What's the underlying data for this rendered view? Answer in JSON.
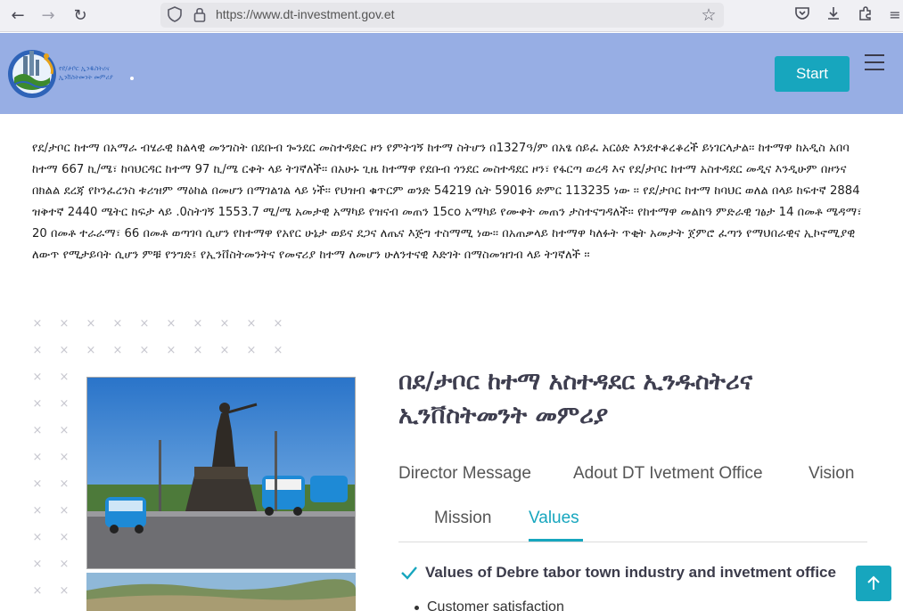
{
  "browser": {
    "url": "https://www.dt-investment.gov.et",
    "back_icon": "←",
    "forward_icon": "→",
    "reload_icon": "↻",
    "shield_icon": "⛉",
    "lock_icon": "🔒",
    "star_icon": "☆",
    "pocket_icon": "◘",
    "download_icon": "⤓",
    "extensions_icon": "✚",
    "menu_icon": "≡"
  },
  "header": {
    "start_label": "Start",
    "bg_color": "#97aee4",
    "accent_color": "#17a6be"
  },
  "intro": {
    "paragraph": "የደ/ታቦር ከተማ በአማራ ብሄራዊ ክልላዊ መንግስት በደቡብ ጐንደር መስተዳድር ዞን የምትገኝ ከተማ ስትሆን በ1327ዓ/ም በአፄ ሰይፈ አርዕድ እንደተቆረቆረች ይነገርላታል፡፡ ከተማዋ ከአዲስ አበባ ከተማ 667 ኪ/ሜ፣ ከባህርዳር ከተማ 97 ኪ/ሜ ርቀት ላይ ትገኛለች፡፡ በአሁኑ ጊዜ ከተማዋ የደቡብ ጎንደር መስተዳደር ዞን፣ የፋርጣ ወረዳ እና የደ/ታቦር ከተማ አስተዳደር መዲና እንዲሁም በዞንና በክልል ደረጃ የኮንፈረንስ ቱሪዝም ማዕከል በመሆን በማገልገል ላይ ነች፡፡ የህዝብ ቁጥርም ወንድ 54219 ሴት 59016 ድምር 113235 ነው ፡፡ የደ/ታቦር ከተማ ከባህር ወለል በላይ ከፍተኛ 2884 ዝቅተኛ 2440 ሜትር ከፍታ ላይ .0ስትገኝ 1553.7 ሚ/ሜ አመታዊ አማካይ የዝናብ መጠን 15co አማካይ የሙቀት መጠን ታስተናግዳለች፡፡ የከተማዋ መልክዓ ምድራዊ ገፅታ 14 በመቶ ሜዳማ፣ 20 በመቶ ተራራማ፣ 66 በመቶ ወጣገባ ሲሆን የከተማዋ የአየር ሁኔታ ወይና ደጋና ለጤና እጅግ ተስማሚ ነው፡፡ በአጠቃላይ ከተማዋ ካለፉት ጥቂት አመታት ጀምሮ ፈጣን የማህበራዊና ኢኮኖሚያዊ ለውጥ የሚታይባት ሲሆን ምቹ የንግድ፤ የኢንቨስትመንትና የመኖሪያ ከተማ ለመሆን ሁለንተናዊ እድገት በማስመዝገብ ላይ ትገኛለች ፡፡"
  },
  "office": {
    "title": "በደ/ታቦር ከተማ አስተዳደር ኢንዱስትሪና ኢንቨስትመንት መምሪያ"
  },
  "tabs": [
    {
      "label": "Director Message",
      "active": false
    },
    {
      "label": "Adout DT Ivetment Office",
      "active": false
    },
    {
      "label": "Vision",
      "active": false
    },
    {
      "label": "Mission",
      "active": false
    },
    {
      "label": "Values",
      "active": true
    }
  ],
  "values_section": {
    "heading": "Values of Debre tabor town industry and invetment office",
    "items": [
      "Customer satisfaction"
    ]
  }
}
